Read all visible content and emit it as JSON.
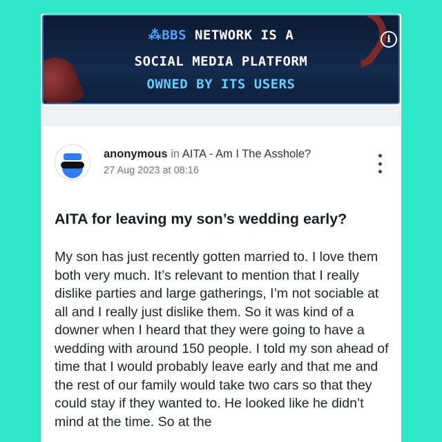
{
  "banner": {
    "logo_text": "BBS",
    "line1_rest": " NETWORK IS A",
    "line2": "SOCIAL MEDIA PLATFORM",
    "line3": "OWNED BY ITS USERS",
    "info_icon": "info-icon"
  },
  "post": {
    "author": "anonymous",
    "in_word": "in",
    "community": "AITA - Am I The Asshole?",
    "timestamp": "27 Aug 2023 at 08:16",
    "more_icon": "vertical-ellipsis-icon",
    "title": "AITA for leaving my son’s wedding early?",
    "body": "My son has just recently gotten married to. I love them both very much. It’s relevant to mention that I really dislike parties and large gatherings, I’m not sociable at all and I really just dislike them. So it was kind of a downer when I heard that they were going to have a wedding with around 150 people. I told my son ahead of time that I would probably leave early and that me and the rest of our family would take two cars so that they could stay if they wanted to. He looked like he didn’t mind at the time. So at the"
  },
  "colors": {
    "page_background": "#2ee8c8",
    "banner_background": "#0d1b33",
    "banner_accent": "#5fd0ff",
    "avatar_accent": "#2f7cf6"
  }
}
